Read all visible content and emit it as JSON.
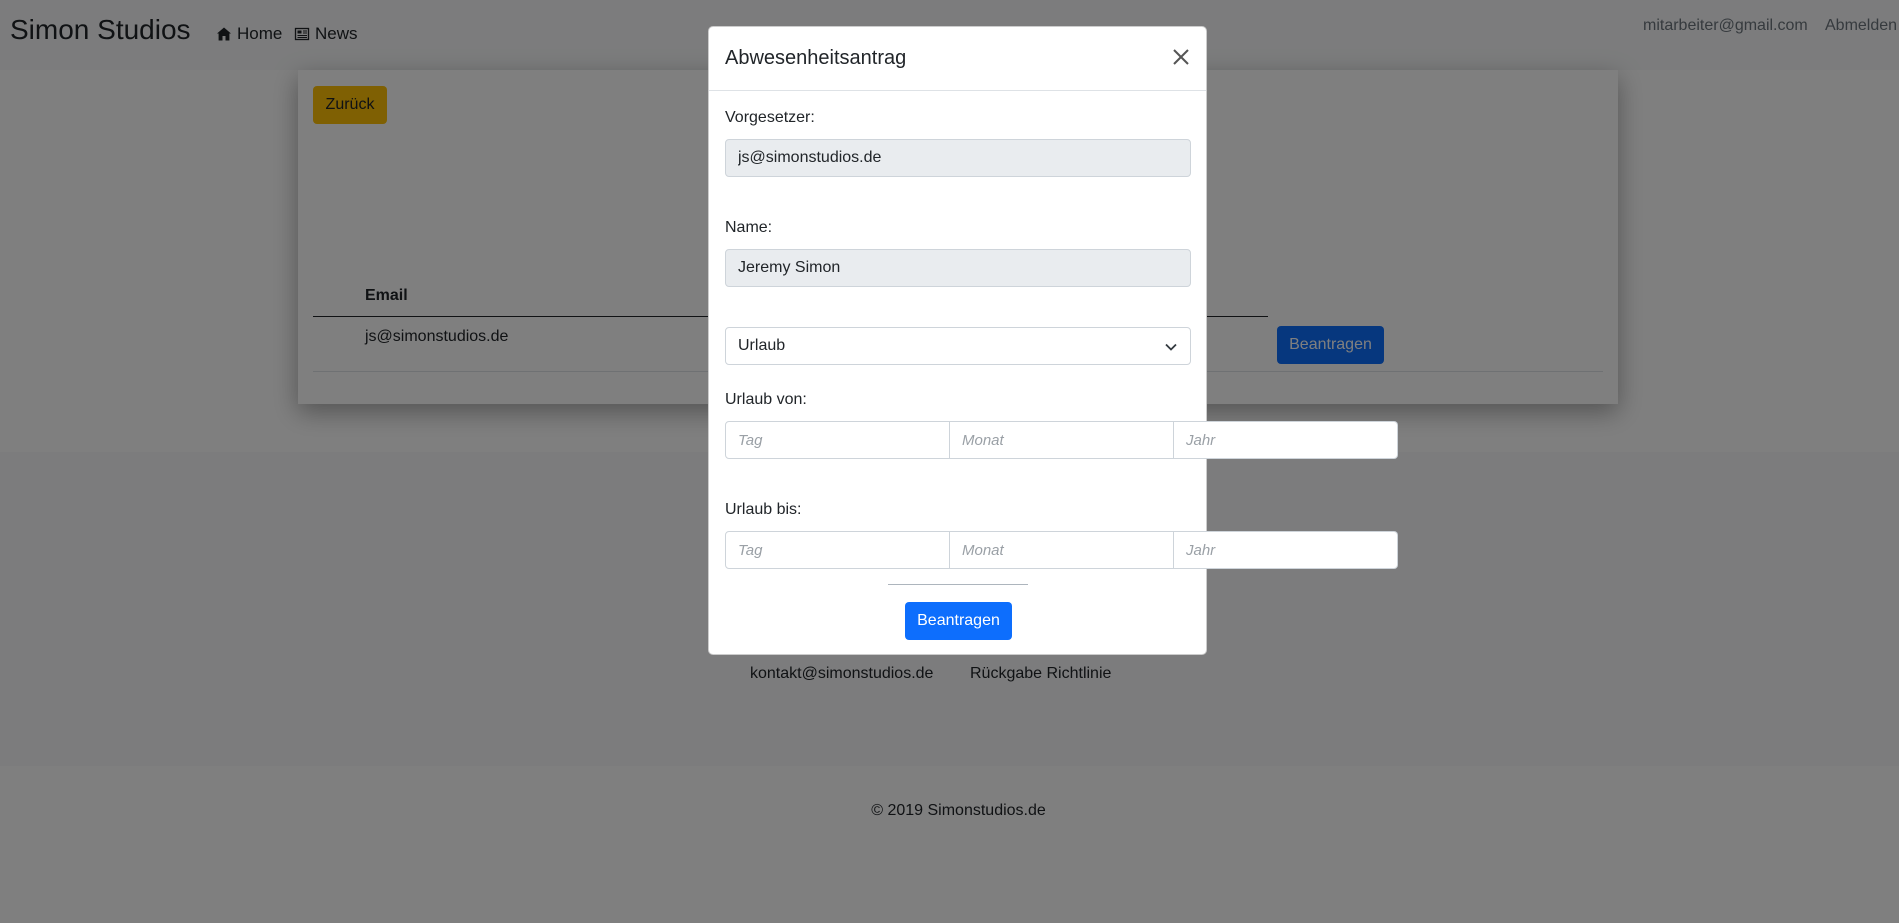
{
  "navbar": {
    "brand": "Simon Studios",
    "links": [
      {
        "label": "Home",
        "icon": "home-icon"
      },
      {
        "label": "News",
        "icon": "newspaper-icon"
      }
    ],
    "user_email": "mitarbeiter@gmail.com",
    "logout_label": "Abmelden"
  },
  "content": {
    "back_button": "Zurück",
    "table": {
      "headers": [
        "Email"
      ],
      "rows": [
        {
          "email": "js@simonstudios.de",
          "action": "Beantragen"
        }
      ]
    }
  },
  "footer": {
    "links": [
      "kontakt@simonstudios.de",
      "Rückgabe Richtlinie"
    ],
    "copyright": "© 2019 Simonstudios.de"
  },
  "modal": {
    "title": "Abwesenheitsantrag",
    "supervisor_label": "Vorgesetzer:",
    "supervisor_value": "js@simonstudios.de",
    "name_label": "Name:",
    "name_value": "Jeremy Simon",
    "type_selected": "Urlaub",
    "from_label": "Urlaub von:",
    "to_label": "Urlaub bis:",
    "date_placeholders": {
      "day": "Tag",
      "month": "Monat",
      "year": "Jahr"
    },
    "submit_label": "Beantragen"
  },
  "colors": {
    "primary": "#0d6efd",
    "warning": "#ffc107",
    "backdrop": "rgba(0,0,0,0.5)"
  }
}
